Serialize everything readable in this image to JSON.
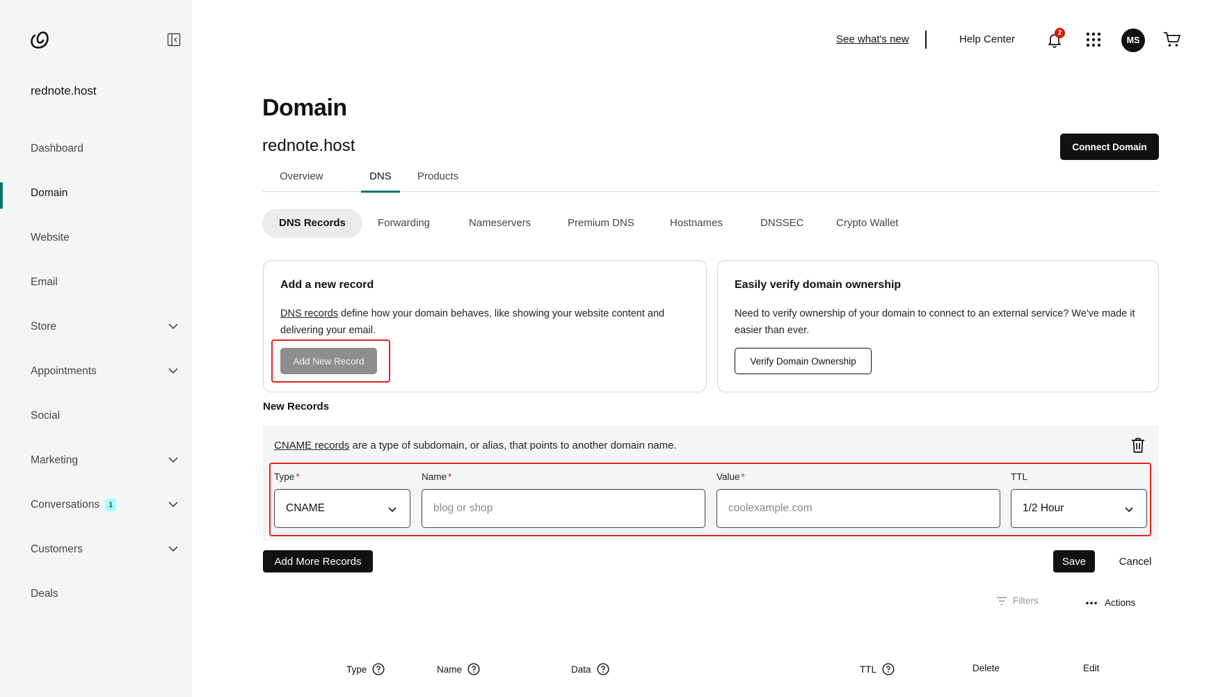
{
  "sidebar": {
    "site_name": "rednote.host",
    "items": [
      {
        "label": "Dashboard"
      },
      {
        "label": "Domain"
      },
      {
        "label": "Website"
      },
      {
        "label": "Email"
      },
      {
        "label": "Store"
      },
      {
        "label": "Appointments"
      },
      {
        "label": "Social"
      },
      {
        "label": "Marketing"
      },
      {
        "label": "Conversations",
        "badge": "1"
      },
      {
        "label": "Customers"
      },
      {
        "label": "Deals"
      }
    ]
  },
  "header": {
    "whats_new": "See what's new",
    "help_center": "Help Center",
    "notification_count": "2",
    "avatar_initials": "MS"
  },
  "main": {
    "title": "Domain",
    "domain": "rednote.host",
    "connect_button": "Connect Domain",
    "tabs": [
      {
        "label": "Overview"
      },
      {
        "label": "DNS"
      },
      {
        "label": "Products"
      }
    ],
    "subtabs": [
      {
        "label": "DNS Records"
      },
      {
        "label": "Forwarding"
      },
      {
        "label": "Nameservers"
      },
      {
        "label": "Premium DNS"
      },
      {
        "label": "Hostnames"
      },
      {
        "label": "DNSSEC"
      },
      {
        "label": "Crypto Wallet"
      }
    ],
    "add_card": {
      "title": "Add a new record",
      "link": "DNS records",
      "text": " define how your domain behaves, like showing your website content and delivering your email.",
      "button": "Add New Record"
    },
    "verify_card": {
      "title": "Easily verify domain ownership",
      "text": "Need to verify ownership of your domain to connect to an external service? We've made it easier than ever.",
      "button": "Verify Domain Ownership"
    },
    "new_records_label": "New Records",
    "record": {
      "desc_link": "CNAME records",
      "desc_text": " are a type of subdomain, or alias, that points to another domain name.",
      "type_label": "Type",
      "type_value": "CNAME",
      "name_label": "Name",
      "name_placeholder": "blog or shop",
      "value_label": "Value",
      "value_placeholder": "coolexample.com",
      "ttl_label": "TTL",
      "ttl_value": "1/2 Hour",
      "required_mark": "*"
    },
    "add_more_button": "Add More Records",
    "save_button": "Save",
    "cancel_button": "Cancel",
    "filters_label": "Filters",
    "actions_label": "Actions",
    "table_headers": [
      {
        "label": "Type"
      },
      {
        "label": "Name"
      },
      {
        "label": "Data"
      },
      {
        "label": "TTL"
      },
      {
        "label": "Delete"
      },
      {
        "label": "Edit"
      }
    ]
  },
  "colors": {
    "accent": "#09757a",
    "highlight_box": "#e3241f",
    "notification": "#db1802"
  }
}
